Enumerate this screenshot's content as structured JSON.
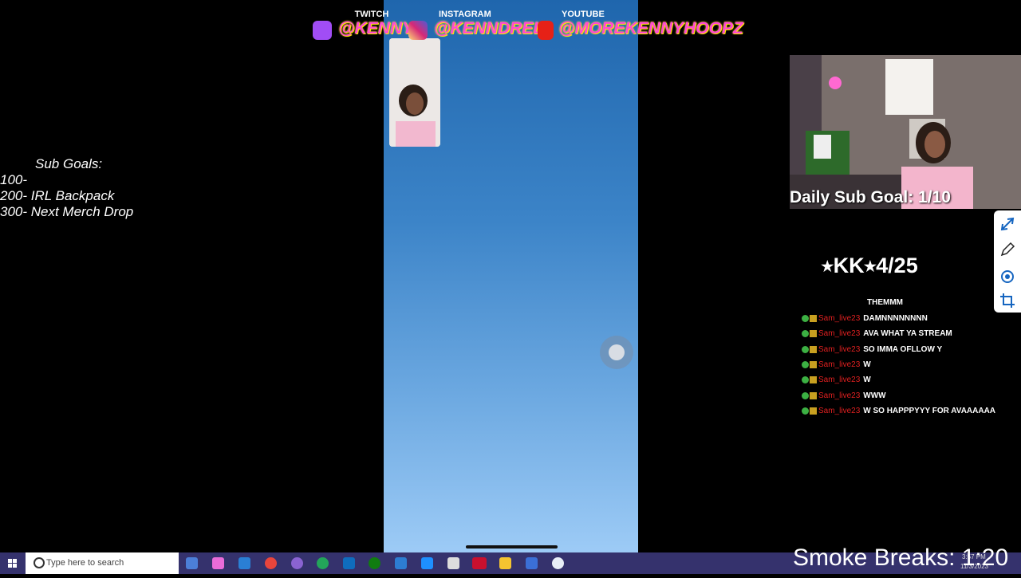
{
  "sub_goals": {
    "title": "Sub Goals:",
    "items": [
      "100-",
      "200- IRL Backpack",
      "300- Next Merch Drop"
    ]
  },
  "social": {
    "twitch_label": "TWITCH",
    "twitch_handle": "@KENNY",
    "instagram_label": "INSTAGRAM",
    "instagram_handle": "@KENNDRELL",
    "youtube_label": "YOUTUBE",
    "youtube_handle": "@MOREKENNYHOOPZ"
  },
  "daily_goal": "Daily Sub Goal: 1/10",
  "kk_counter": "⭑KK⭑4/25",
  "chat": {
    "top_message": "THEMMM",
    "lines": [
      {
        "user": "Sam_live23",
        "message": "DAMNNNNNNNN"
      },
      {
        "user": "Sam_live23",
        "message": "AVA WHAT YA STREAM"
      },
      {
        "user": "Sam_live23",
        "message": "SO IMMA OFLLOW Y"
      },
      {
        "user": "Sam_live23",
        "message": "W"
      },
      {
        "user": "Sam_live23",
        "message": "W"
      },
      {
        "user": "Sam_live23",
        "message": "WWW"
      },
      {
        "user": "Sam_live23",
        "message": "W SO HAPPPYYY FOR AVAAAAAA"
      }
    ]
  },
  "taskbar": {
    "search_placeholder": "Type here to search",
    "time": "3:57 PM",
    "date": "11/3/2023"
  },
  "smoke_breaks": "Smoke Breaks: 1:20",
  "colors": {
    "taskbar": "#35326d",
    "handle": "#ff4bd1",
    "chat_user": "#e02020"
  }
}
